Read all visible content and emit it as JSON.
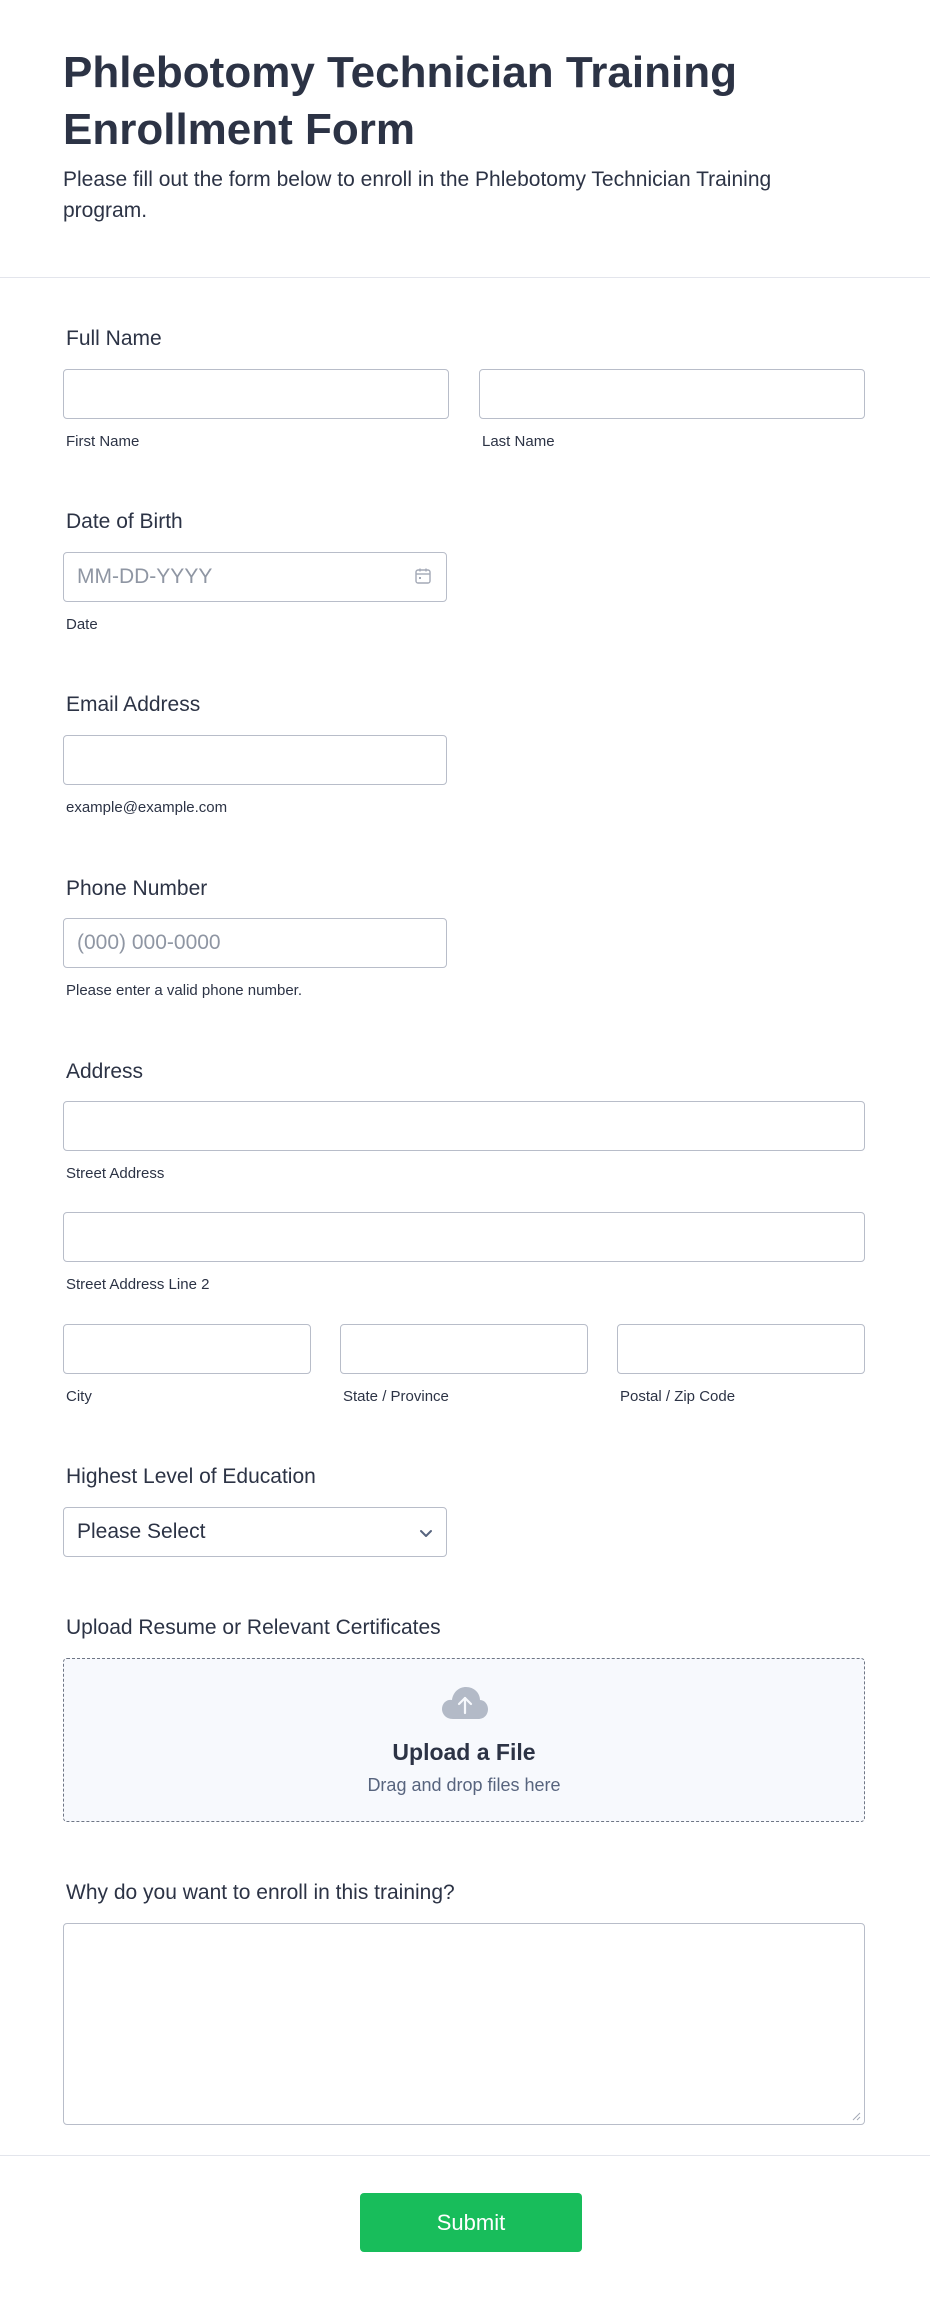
{
  "header": {
    "title": "Phlebotomy Technician Training Enrollment Form",
    "subtitle": "Please fill out the form below to enroll in the Phlebotomy Technician Training program."
  },
  "full_name": {
    "label": "Full Name",
    "first_sublabel": "First Name",
    "last_sublabel": "Last Name",
    "first_value": "",
    "last_value": ""
  },
  "dob": {
    "label": "Date of Birth",
    "placeholder": "MM-DD-YYYY",
    "sublabel": "Date",
    "icon": "calendar-icon"
  },
  "email": {
    "label": "Email Address",
    "sublabel": "example@example.com",
    "value": ""
  },
  "phone": {
    "label": "Phone Number",
    "placeholder": "(000) 000-0000",
    "sublabel": "Please enter a valid phone number."
  },
  "address": {
    "label": "Address",
    "street_sublabel": "Street Address",
    "street2_sublabel": "Street Address Line 2",
    "city_sublabel": "City",
    "state_sublabel": "State / Province",
    "zip_sublabel": "Postal / Zip Code"
  },
  "education": {
    "label": "Highest Level of Education",
    "selected": "Please Select",
    "icon": "chevron-down-icon"
  },
  "upload": {
    "label": "Upload Resume or Relevant Certificates",
    "title": "Upload a File",
    "subtitle": "Drag and drop files here",
    "icon": "cloud-upload-icon"
  },
  "reason": {
    "label": "Why do you want to enroll in this training?",
    "value": ""
  },
  "submit": {
    "label": "Submit",
    "color": "#18bd5b"
  },
  "colors": {
    "text": "#2c3345",
    "border": "#b8bdc9",
    "placeholder": "#8f96a3",
    "accent": "#18bd5b"
  }
}
